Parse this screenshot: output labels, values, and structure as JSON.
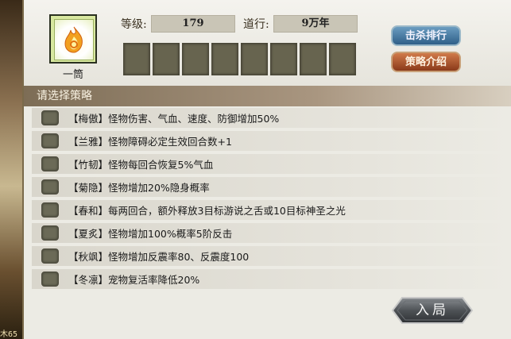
{
  "background": {
    "left_edge_text": "木65"
  },
  "avatar": {
    "name": "一筒"
  },
  "stats": {
    "level_label": "等级:",
    "level_value": "179",
    "daoxing_label": "道行:",
    "daoxing_value": "9万年"
  },
  "buttons": {
    "kill_rank": "击杀排行",
    "strategy_intro": "策略介绍",
    "enter": "入局"
  },
  "section": {
    "title": "请选择策略"
  },
  "strategies": [
    {
      "text": "【梅傲】怪物伤害、气血、速度、防御增加50%"
    },
    {
      "text": "【兰雅】怪物障碍必定生效回合数+1"
    },
    {
      "text": "【竹韧】怪物每回合恢复5%气血"
    },
    {
      "text": "【菊隐】怪物增加20%隐身概率"
    },
    {
      "text": "【春和】每两回合，额外释放3目标游说之舌或10目标神圣之光"
    },
    {
      "text": "【夏炙】怪物增加100%概率5阶反击"
    },
    {
      "text": "【秋飒】怪物增加反震率80、反震度100"
    },
    {
      "text": "【冬凛】宠物复活率降低20%"
    }
  ],
  "colors": {
    "panel_bg": "#ecebe4",
    "slot": "#67644f",
    "rank_button": "#2f5f88",
    "intro_button": "#8a3a1a"
  }
}
